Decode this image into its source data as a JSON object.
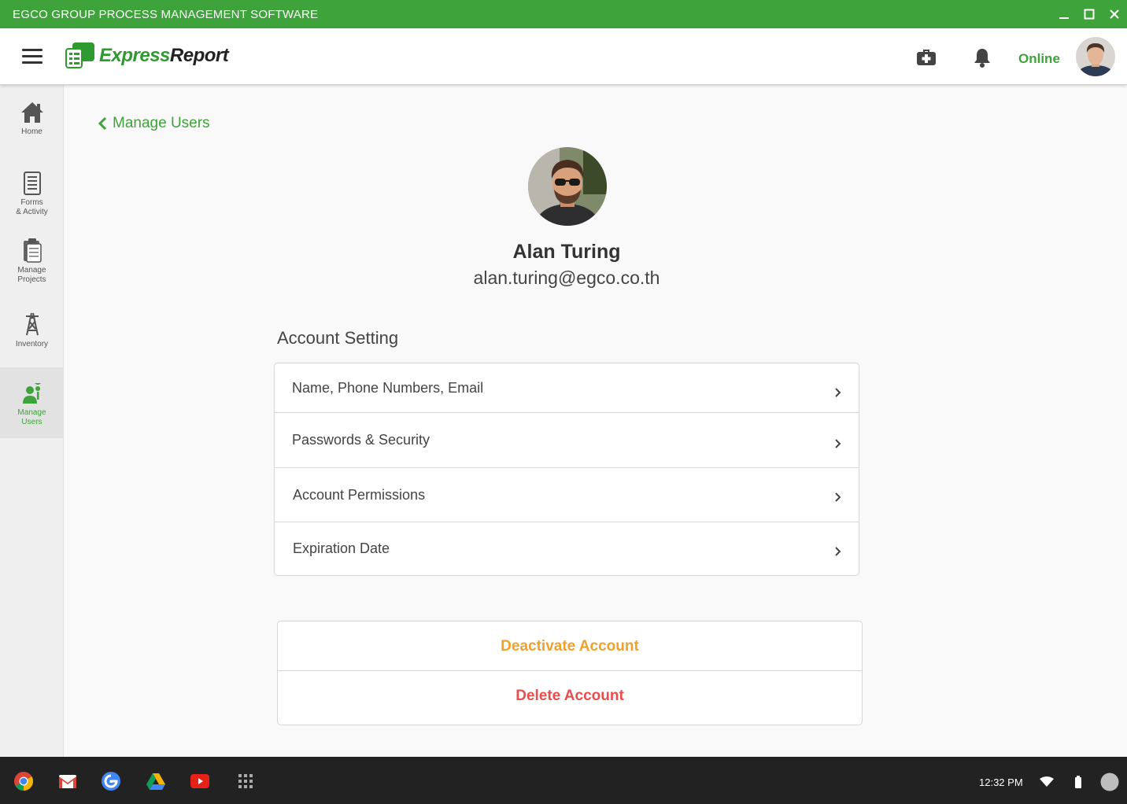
{
  "window": {
    "title": "EGCO GROUP PROCESS MANAGEMENT SOFTWARE"
  },
  "header": {
    "logo_part1": "Express",
    "logo_part2": "Report",
    "status": "Online",
    "icons": [
      "menu-icon",
      "first-aid-kit-icon",
      "bell-icon"
    ]
  },
  "sidebar": {
    "items": [
      {
        "label": "Home",
        "icon": "home-icon"
      },
      {
        "label": "Forms\n& Activity",
        "icon": "forms-icon"
      },
      {
        "label": "Manage\nProjects",
        "icon": "clipboard-icon"
      },
      {
        "label": "Inventory",
        "icon": "transmission-tower-icon"
      },
      {
        "label": "Manage\nUsers",
        "icon": "manage-users-icon",
        "active": true
      }
    ]
  },
  "main": {
    "back_label": "Manage Users",
    "user": {
      "name": "Alan Turing",
      "email": "alan.turing@egco.co.th"
    },
    "section_title": "Account Setting",
    "settings": [
      {
        "label": "Name, Phone Numbers, Email"
      },
      {
        "label": "Passwords & Security"
      },
      {
        "label": "Account Permissions"
      },
      {
        "label": "Expiration Date"
      }
    ],
    "deactivate_label": "Deactivate Account",
    "delete_label": "Delete Account"
  },
  "taskbar": {
    "apps": [
      "chrome-icon",
      "gmail-icon",
      "google-icon",
      "drive-icon",
      "youtube-icon",
      "app-launcher-icon"
    ],
    "time": "12:32 PM"
  },
  "colors": {
    "brand": "#3ea33a",
    "warning": "#f0a12b",
    "danger": "#eb4d4d"
  }
}
